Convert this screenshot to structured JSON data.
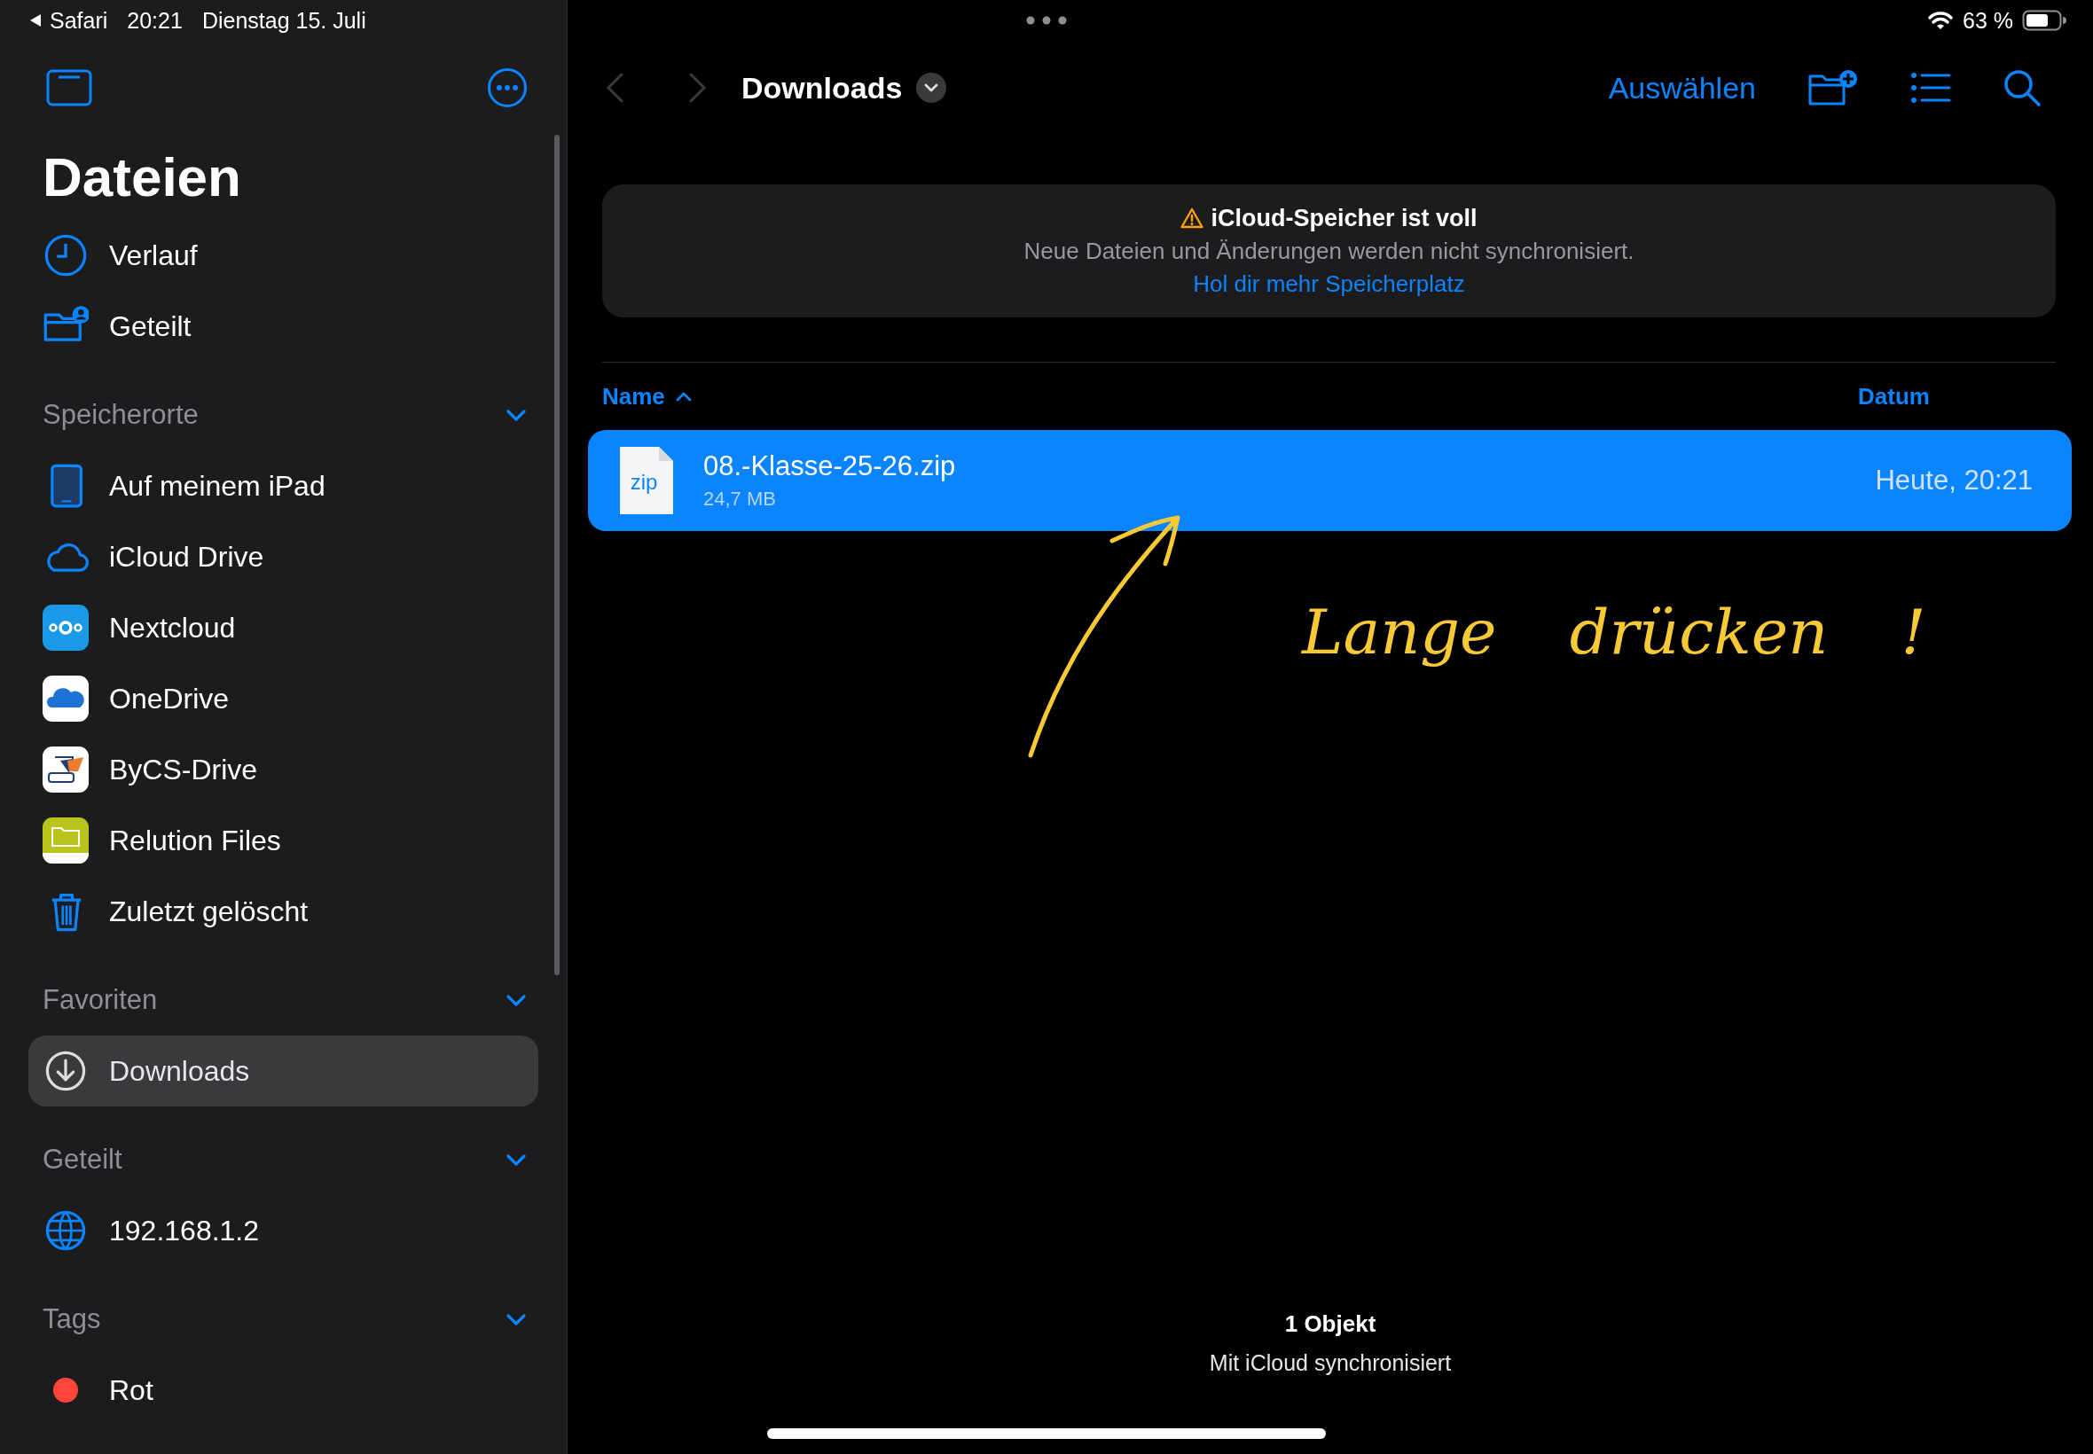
{
  "status_bar": {
    "back_app": "Safari",
    "time": "20:21",
    "date": "Dienstag 15. Juli",
    "battery": "63 %"
  },
  "sidebar": {
    "title": "Dateien",
    "items": [
      {
        "kind": "clock",
        "label": "Verlauf",
        "selected": false
      },
      {
        "kind": "shared-folder",
        "label": "Geteilt",
        "selected": false
      }
    ],
    "sections": [
      {
        "title": "Speicherorte",
        "expanded": true,
        "items": [
          {
            "kind": "ipad",
            "label": "Auf meinem iPad",
            "selected": false
          },
          {
            "kind": "cloud",
            "label": "iCloud Drive",
            "selected": false
          },
          {
            "kind": "nextcloud",
            "label": "Nextcloud",
            "selected": false
          },
          {
            "kind": "onedrive",
            "label": "OneDrive",
            "selected": false
          },
          {
            "kind": "bycs",
            "label": "ByCS-Drive",
            "selected": false
          },
          {
            "kind": "relution",
            "label": "Relution Files",
            "selected": false
          },
          {
            "kind": "trash",
            "label": "Zuletzt gelöscht",
            "selected": false
          }
        ]
      },
      {
        "title": "Favoriten",
        "expanded": true,
        "items": [
          {
            "kind": "download",
            "label": "Downloads",
            "selected": true
          }
        ]
      },
      {
        "title": "Geteilt",
        "expanded": true,
        "items": [
          {
            "kind": "globe",
            "label": "192.168.1.2",
            "selected": false
          }
        ]
      },
      {
        "title": "Tags",
        "expanded": true,
        "items": [
          {
            "kind": "tag",
            "label": "Rot",
            "color": "#ff453a",
            "selected": false
          }
        ]
      }
    ]
  },
  "toolbar": {
    "title": "Downloads",
    "action": "Auswählen"
  },
  "banner": {
    "title": "iCloud-Speicher ist voll",
    "message": "Neue Dateien und Änderungen werden nicht synchronisiert.",
    "link": "Hol dir mehr Speicherplatz"
  },
  "columns": [
    {
      "label": "Name",
      "sorted": true
    },
    {
      "label": "Datum",
      "sorted": false
    }
  ],
  "files": [
    {
      "name": "08.-Klasse-25-26.zip",
      "type": "zip",
      "size": "24,7 MB",
      "date": "Heute, 20:21",
      "selected": true
    }
  ],
  "annotation": {
    "text": "Lange drücken !"
  },
  "footer": {
    "count": "1 Objekt",
    "sync": "Mit iCloud synchronisiert"
  }
}
